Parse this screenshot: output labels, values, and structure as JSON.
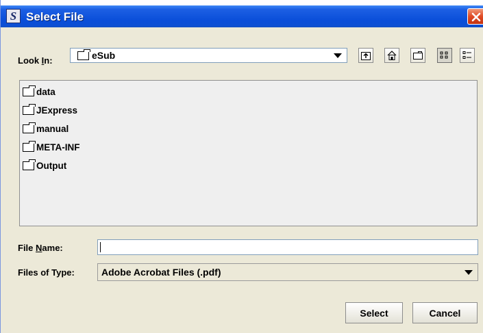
{
  "window": {
    "title": "Select File",
    "app_icon_letter": "S"
  },
  "look_in": {
    "label_pre": "Look ",
    "label_mnemonic": "I",
    "label_post": "n:",
    "value": "eSub"
  },
  "toolbar": {
    "icons": [
      "up-folder-icon",
      "home-icon",
      "new-folder-icon",
      "list-view-icon",
      "details-view-icon"
    ]
  },
  "files": [
    {
      "name": "data",
      "type": "folder"
    },
    {
      "name": "JExpress",
      "type": "folder"
    },
    {
      "name": "manual",
      "type": "folder"
    },
    {
      "name": "META-INF",
      "type": "folder"
    },
    {
      "name": "Output",
      "type": "folder"
    }
  ],
  "file_name": {
    "label_pre": "File ",
    "label_mnemonic": "N",
    "label_post": "ame:",
    "value": ""
  },
  "file_type": {
    "label": "Files of Type:",
    "value": "Adobe Acrobat Files (.pdf)"
  },
  "buttons": {
    "select": "Select",
    "cancel": "Cancel"
  },
  "colors": {
    "title_bar": "#0a4ed9",
    "dialog_bg": "#ece9d8",
    "list_bg": "#efefef",
    "close_button": "#e04a25"
  }
}
